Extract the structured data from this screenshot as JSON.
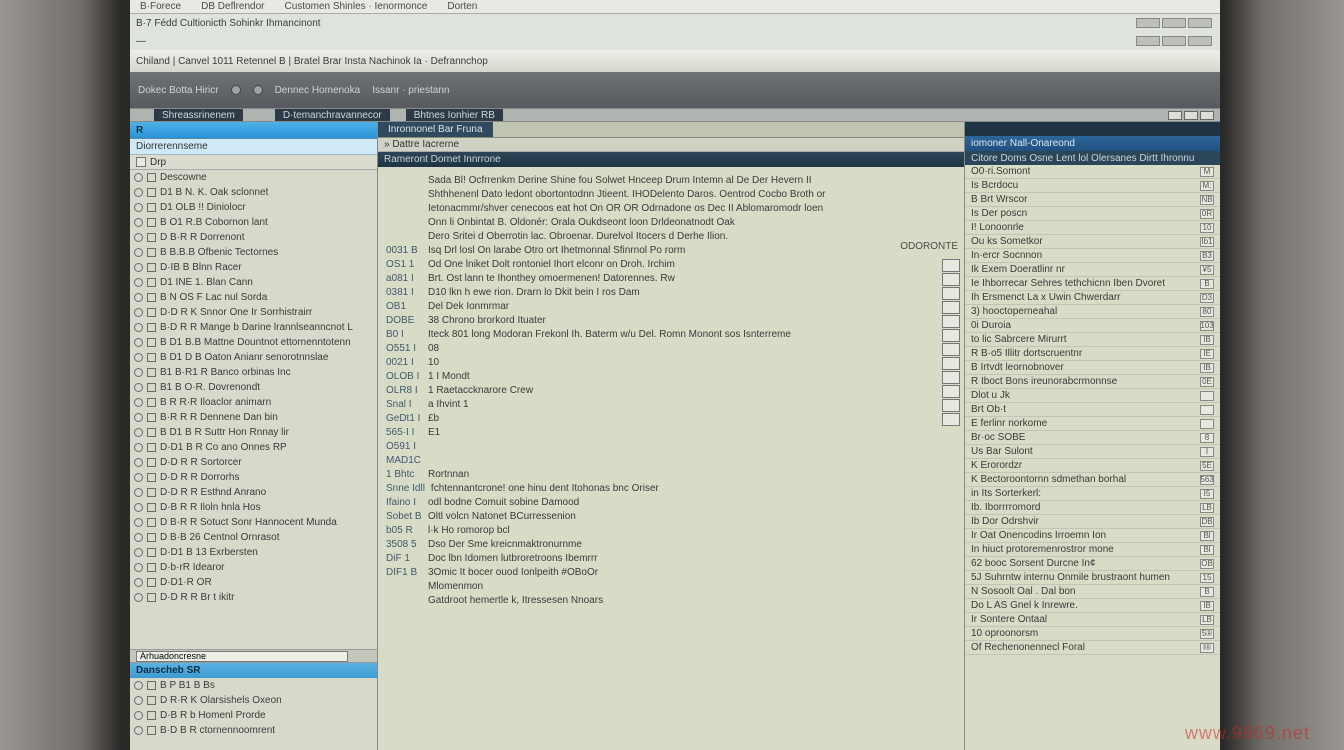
{
  "window": {
    "tabs": [
      "B·Forece",
      "DB Deflrendor",
      "Customen Shinles · Ienormonce",
      "Dorten"
    ],
    "secondbar": "B·7 Fédd   Cultionicth Sohinkr  Ihmancinont",
    "thirdbar": "—",
    "breadcrumb": "Chiland | Canvel 1011 Retennel B | Bratel Brar Insta Nachinok Ia · Defrannchop"
  },
  "toolbar": {
    "left": "Dokec Botta Hiricr",
    "mid1": "Dennec Homenoka",
    "mid2": "Issanr · priestann"
  },
  "thin": {
    "left": "",
    "tab1": "Shreassrinenem",
    "mid": "",
    "tab2": "D·temanchravannecor",
    "tab3": "Bhtnes Ionhier RB"
  },
  "sidebar": {
    "header": "R",
    "subheader": "Diorrerennseme",
    "filter": "Drp",
    "items": [
      "Descowne",
      "D1 B N. K.  Oak sclonnet",
      "D1 OLB !!  Diniolocr",
      "B O1 R.B  Cobornon lant",
      "D B·R  R  Dorrenont",
      "B B.B.B  Ofbenic Tectornes",
      "D·IB B  Blnn Racer",
      "D1 INE  1.  Blan Cann",
      "B N OS F  Lac nul Sorda",
      "D·D R  K  Snnor One Ir Sorrhistrairr",
      "B·D R  R  Mange b Darine lrannlseanncnot L",
      "B D1 B.B  Mattne Dountnot ettornenntotenn",
      "B D1 D B  Oaton Anianr senorotnnslae",
      "B1 B·R1 R  Banco orbinas Inc",
      "B1 B O·R.  Dovrenondt",
      "B R R·R  Iloaclor animarn",
      "B·R R R  Dennene Dan bin",
      "B D1 B R  Suttr Hon Rnnay lir",
      "D·D1 B R  Co ano Onnes RP",
      "D·D R  R  Sortorcer",
      "D·D R  R  Dorrorhs",
      "D·D R  R  Esthnd Anrano",
      "D·B  R  R  Iloln hnla Hos",
      "D B·R  R  Sotuct Sonr Hannocent Munda",
      "D B·B  26  Centnol Ornrasot",
      "D·D1 B  13  Exrbersten",
      "D·b·rR  Idearor",
      "D·D1·R   OR",
      "D·D R  R  Br t ikitr"
    ],
    "search": "Arhuadoncresne",
    "section2": "Danscheb SR",
    "items2": [
      "B P B1 B  Bs",
      "D R·R  K  Olarsishels Oxeon",
      "D·B  R  b  Homenl Prorde",
      "B·D B  R  ctornennoomrent"
    ]
  },
  "main": {
    "tab_active": "Inronnonel Bar Fruna",
    "tab2": "",
    "subhead": "» Dattre Iacrerne",
    "colhead": [
      "Rameront  Dornet Innrrone",
      ""
    ],
    "status_head": "ODORONTE",
    "lines": [
      {
        "n": "",
        "t": "Sada Bl! Ocfrrenkm Derine Shine fou Solwet Hnceep Drum Intemn al De Der Hevern II"
      },
      {
        "n": "",
        "t": "Shthhenenl Dato ledont obortontodnn Jtieent. IHODelento Daros. Oentrod Cocbo Broth or"
      },
      {
        "n": "",
        "t": "Ietonacmmr/shver cenecoos eat hot  On  OR  OR  Odrnadone os Dec  II Ablomaromodr loen"
      },
      {
        "n": "",
        "t": "Onn  li  Onbintat B.  Oldonér:  Orala  Oukdseont loon Drldeonatnodt Oak"
      },
      {
        "n": "",
        "t": "Dero Sritei d Oberrotin lac.  Obroenar.  Durelvol Itocers d  Derhe Ilion."
      },
      {
        "n": "0031 B",
        "t": "Isq Drl losl On larabe Otro ort  Ihetmonnal Sfinrnol Po rorm"
      },
      {
        "n": "OS1 1",
        "t": "Od  One lniket Dolt rontoniel Ihort elconr on Droh. Irchim"
      },
      {
        "n": "a081 I",
        "t": "Brt.  Ost lann te Ihonthey omoermenen!  Datorennes.  Rw"
      },
      {
        "n": "0381 I",
        "t": "D10 lkn h ewe rion.  Drarn lo Dkit bein I ros Dam"
      },
      {
        "n": "OB1",
        "t": "Del  Dek Ionmrmar"
      },
      {
        "n": "DOBE",
        "t": "38  Chrono brorkord Ituater"
      },
      {
        "n": "B0 I",
        "t": "Iteck 801 long Modoran Frekonl  Ih.  Baterm w/u Del.  Romn Monont sos Isnterreme"
      },
      {
        "n": "O551 I",
        "t": "08"
      },
      {
        "n": "0021 I",
        "t": "10"
      },
      {
        "n": "OLOB I",
        "t": "1 I Mondt"
      },
      {
        "n": "OLR8 I",
        "t": "1  Raetaccknarore  Crew"
      },
      {
        "n": "Snal I",
        "t": "a Ihvint 1"
      },
      {
        "n": "GeDt1 I",
        "t": "£b"
      },
      {
        "n": "565·I I",
        "t": "E1"
      },
      {
        "n": "O591 I",
        "t": ""
      },
      {
        "n": "MAD1C",
        "t": ""
      },
      {
        "n": "1 Bhtc",
        "t": "Rortnnan"
      },
      {
        "n": "Snne Idll",
        "t": "fchtennantcrone! one hinu dent Itohonas bnc Oriser"
      },
      {
        "n": "Ifaino I",
        "t": "odl bodne Comuit sobine Damood"
      },
      {
        "n": "Sobet B",
        "t": "Oltl  volcn Natonet  BCurressenion"
      },
      {
        "n": "b05 R",
        "t": "l·k  Ho romorop bcl"
      },
      {
        "n": "3508 5",
        "t": "Dso Der Sme kreicnmaktronurnme"
      },
      {
        "n": "DiF 1",
        "t": "Doc  lbn Idomen lutbroretroons Ibemrrr"
      },
      {
        "n": "DIF1 B",
        "t": "3Omic It bocer ouod Ionlpeith #OBoOr"
      },
      {
        "n": "",
        "t": "Mlomenmon"
      },
      {
        "n": "",
        "t": "Gatdroot hemertle k, Itressesen Nnoars"
      }
    ],
    "status_cells": 12
  },
  "right": {
    "tab": "",
    "title": "iomoner Nall-Onareond",
    "colhead": "Citore Doms Osne Lent lol Olersanes  Dirtt Ihronnu",
    "items": [
      {
        "label": "O0·ri.Somont",
        "val": "M"
      },
      {
        "label": "Is  Bcrdocu",
        "val": "M:"
      },
      {
        "label": "B  Brt  Wrscor",
        "val": "NB"
      },
      {
        "label": "Is Der  poscn",
        "val": "0R"
      },
      {
        "label": "I! Lonoonrle",
        "val": "10"
      },
      {
        "label": "Ou ks Sometkor",
        "val": "Ib1"
      },
      {
        "label": "In·ercr  Socnnon",
        "val": "B3"
      },
      {
        "label": "Ik  Exem Doeratlinr  nr",
        "val": "¥5"
      },
      {
        "label": "Ie Ihborrecar Sehres tethchicnn Iben Dvoret",
        "val": "B"
      },
      {
        "label": "Ih Ersmenct La x Uwin Chwerdarr",
        "val": "D3"
      },
      {
        "label": "3) hooctoperneahal",
        "val": "80"
      },
      {
        "label": "0i  Duroia",
        "val": "103"
      },
      {
        "label": "to lic  Sabrcere   Mirurrt",
        "val": "IB"
      },
      {
        "label": "R  B·o5  Illitr dortscruentnr",
        "val": "IE"
      },
      {
        "label": "B  Irtvdt leornobnover",
        "val": "IB"
      },
      {
        "label": "R  Iboct Bons  ireunorabcrmonnse",
        "val": "0E"
      },
      {
        "label": "Dlot u Jk",
        "val": ""
      },
      {
        "label": "Brt Ob·t",
        "val": ""
      },
      {
        "label": "E ferlinr norkome",
        "val": ""
      },
      {
        "label": "Br·oc  SOBE",
        "val": "8"
      },
      {
        "label": "Us  Bar Sulont",
        "val": "I"
      },
      {
        "label": "K  Erorordzr",
        "val": "5E"
      },
      {
        "label": "K  Bectoroontornn  sdmethan borhal",
        "val": "563"
      },
      {
        "label": "in Its Sorterkerl:",
        "val": "I5"
      },
      {
        "label": "Ib.  Iborrrromord",
        "val": "LB"
      },
      {
        "label": "Ib Dor  Odrshvir",
        "val": "DB"
      },
      {
        "label": "Ir Oat  Onencodins Irroemn  Ion",
        "val": "Bl"
      },
      {
        "label": "In hiuct protoremenrostror mone",
        "val": "Bl"
      },
      {
        "label": "62 booc Sorsent Durcne In¢",
        "val": "OB"
      },
      {
        "label": "5J  Suhrntw internu Onmile brustraont humen",
        "val": "15"
      },
      {
        "label": "N Sosoolt Oal . Dal bon",
        "val": "B"
      },
      {
        "label": "Do L AS Gnel k Inrewre.",
        "val": "IB"
      },
      {
        "label": "Ir Sontere Ontaal",
        "val": "LB"
      },
      {
        "label": "10  oproonorsm",
        "val": "5®"
      },
      {
        "label": "Of Rechenonennecl Foral",
        "val": "I®"
      }
    ]
  },
  "watermark": "www.9969.net"
}
